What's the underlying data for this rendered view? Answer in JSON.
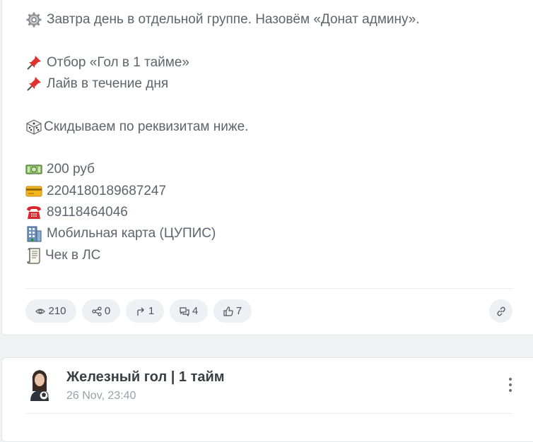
{
  "post": {
    "lines": [
      {
        "icon": "gear-icon",
        "text": "Завтра день в отдельной группе. Назовём «Донат админу»."
      },
      {
        "icon": "pushpin-icon",
        "text": "Отбор «Гол в 1 тайме»"
      },
      {
        "icon": "pushpin-icon",
        "text": "Лайв в течение дня"
      },
      {
        "icon": "dice-icon",
        "text": "Скидываем по реквизитам ниже."
      },
      {
        "icon": "banknote-icon",
        "text": "200 руб"
      },
      {
        "icon": "credit-card-icon",
        "text": "2204180189687247"
      },
      {
        "icon": "telephone-icon",
        "text": "89118464046"
      },
      {
        "icon": "building-icon",
        "text": "Мобильная карта (ЦУПИС)"
      },
      {
        "icon": "receipt-icon",
        "text": "Чек в ЛС"
      }
    ],
    "stats": {
      "views": "210",
      "shares": "0",
      "forwards": "1",
      "comments": "4",
      "likes": "7"
    }
  },
  "next_post": {
    "channel_name": "Железный гол | 1 тайм",
    "time": "26 Nov, 23:40"
  },
  "colors": {
    "background": "#f1f2f4",
    "card": "#ffffff",
    "pill": "#eef0f3",
    "text": "#5f646c"
  }
}
